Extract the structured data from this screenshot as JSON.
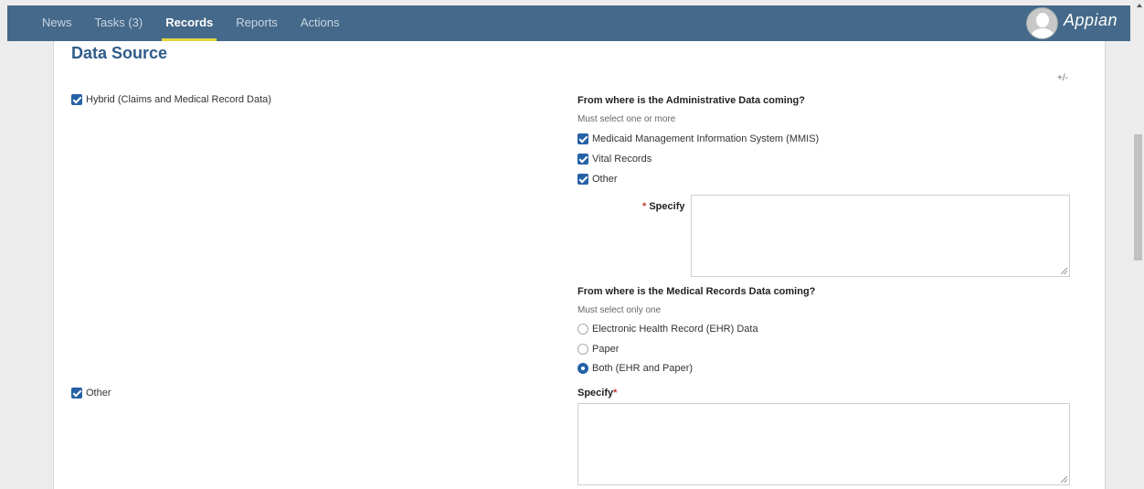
{
  "nav": {
    "items": [
      "News",
      "Tasks (3)",
      "Records",
      "Reports",
      "Actions"
    ],
    "active": "Records",
    "logo": "Appian"
  },
  "section": {
    "title": "Data Source",
    "toggle": "+/-"
  },
  "left": {
    "hybrid_label": "Hybrid (Claims and Medical Record Data)",
    "other_label": "Other"
  },
  "admin": {
    "question": "From where is the Administrative Data coming?",
    "hint": "Must select one or more",
    "options": [
      "Medicaid Management Information System (MMIS)",
      "Vital Records",
      "Other"
    ],
    "specify_req": "*",
    "specify_label": "Specify",
    "specify_value": ""
  },
  "medical": {
    "question": "From where is the Medical Records Data coming?",
    "hint": "Must select only one",
    "options": [
      "Electronic Health Record (EHR) Data",
      "Paper",
      "Both (EHR and Paper)"
    ],
    "selected": "Both (EHR and Paper)"
  },
  "other_specify": {
    "label": "Specify",
    "req": "*",
    "value": ""
  },
  "colors": {
    "topbar": "#45698a",
    "accent": "#2561a6",
    "active_underline": "#e3d541",
    "title": "#2d5c8a"
  }
}
